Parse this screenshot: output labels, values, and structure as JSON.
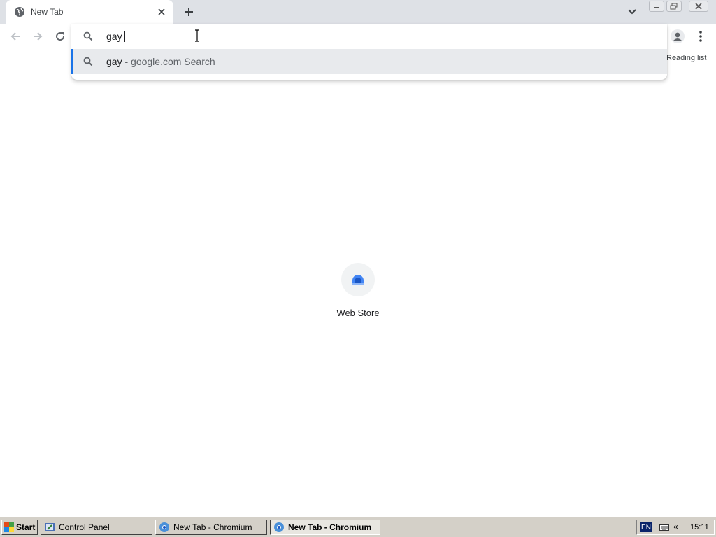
{
  "browser": {
    "tab": {
      "title": "New Tab",
      "favicon": "globe-icon",
      "close_icon": "close-icon"
    },
    "new_tab_icon": "plus-icon",
    "tab_search_icon": "chevron-down-icon",
    "window_controls": [
      "minimize-icon",
      "restore-icon",
      "close-icon"
    ]
  },
  "toolbar": {
    "back_icon": "arrow-left-icon",
    "forward_icon": "arrow-right-icon",
    "reload_icon": "reload-icon",
    "profile_icon": "person-icon",
    "menu_icon": "kebab-menu-icon",
    "reading_list_label": "Reading list"
  },
  "omnibox": {
    "value": "gay",
    "search_icon": "search-icon",
    "suggestions": [
      {
        "query": "gay",
        "separator": " - ",
        "description": "google.com Search",
        "icon": "search-icon"
      }
    ]
  },
  "ntp": {
    "shortcuts": [
      {
        "label": "Web Store",
        "icon": "web-store-icon"
      }
    ]
  },
  "taskbar": {
    "start_label": "Start",
    "buttons": [
      {
        "label": "Control Panel",
        "icon": "control-panel-icon",
        "active": false
      },
      {
        "label": "New Tab - Chromium",
        "icon": "chromium-icon",
        "active": false
      },
      {
        "label": "New Tab - Chromium",
        "icon": "chromium-icon",
        "active": true
      }
    ],
    "tray": {
      "language": "EN",
      "expand_label": "«",
      "clock": "15:11"
    }
  },
  "colors": {
    "tabstrip_bg": "#dee1e6",
    "accent": "#1a73e8",
    "suggestion_selected_bg": "#e8eaed",
    "taskbar_bg": "#d4d0c8"
  }
}
